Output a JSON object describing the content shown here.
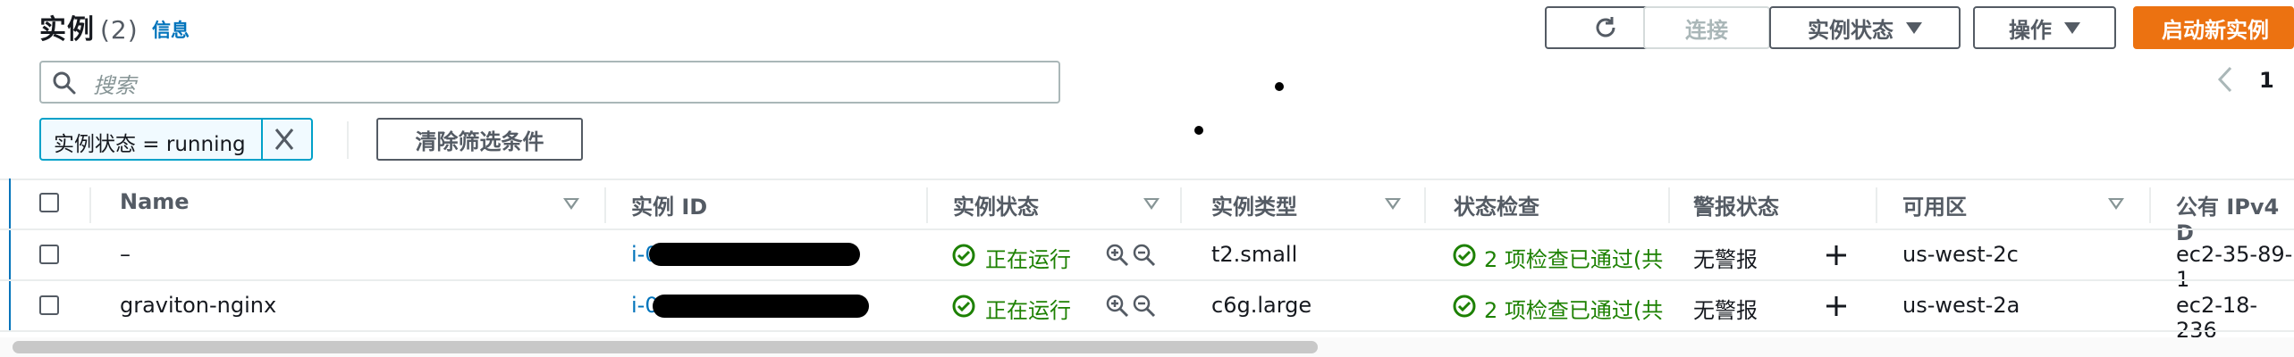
{
  "header": {
    "title": "实例",
    "count": "(2)",
    "info_link": "信息",
    "connect_label": "连接",
    "instance_state_label": "实例状态",
    "actions_label": "操作",
    "launch_label": "启动新实例"
  },
  "search": {
    "placeholder": "搜索"
  },
  "pagination": {
    "current_page": "1"
  },
  "filter": {
    "token_label": "实例状态 = running",
    "clear_label": "清除筛选条件"
  },
  "table": {
    "columns": [
      "Name",
      "实例 ID",
      "实例状态",
      "实例类型",
      "状态检查",
      "警报状态",
      "可用区",
      "公有 IPv4 D"
    ],
    "rows": [
      {
        "name": "–",
        "instance_id": "i-0",
        "state": "正在运行",
        "type": "t2.small",
        "status_check": "2 项检查已通过(共",
        "alarm": "无警报",
        "az": "us-west-2c",
        "ipv4": "ec2-35-89-1"
      },
      {
        "name": "graviton-nginx",
        "instance_id": "i-0",
        "state": "正在运行",
        "type": "c6g.large",
        "status_check": "2 项检查已通过(共",
        "alarm": "无警报",
        "az": "us-west-2a",
        "ipv4": "ec2-18-236"
      }
    ]
  },
  "colors": {
    "accent_orange": "#ec7211",
    "link_blue": "#0073bb",
    "success_green": "#1d8102",
    "token_border": "#00a1c9"
  },
  "icons": [
    "refresh-icon",
    "caret-down-icon",
    "search-icon",
    "close-icon",
    "chevron-left-icon",
    "sort-icon",
    "status-ok-icon",
    "zoom-in-icon",
    "zoom-out-icon",
    "add-alarm-icon"
  ]
}
